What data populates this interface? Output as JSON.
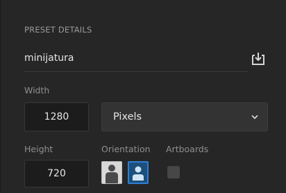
{
  "preset_details": {
    "section_title": "PRESET DETAILS",
    "name_value": "minijatura",
    "save_icon": "save-preset-icon"
  },
  "width": {
    "label": "Width",
    "value": "1280"
  },
  "units": {
    "selected": "Pixels",
    "chevron_icon": "chevron-down-icon"
  },
  "height": {
    "label": "Height",
    "value": "720"
  },
  "orientation": {
    "label": "Orientation",
    "portrait_icon": "portrait-orientation-icon",
    "landscape_icon": "landscape-orientation-icon",
    "selected": "landscape"
  },
  "artboards": {
    "label": "Artboards",
    "checked": false
  },
  "colors": {
    "accent": "#2f7fd6",
    "background": "#262626"
  }
}
